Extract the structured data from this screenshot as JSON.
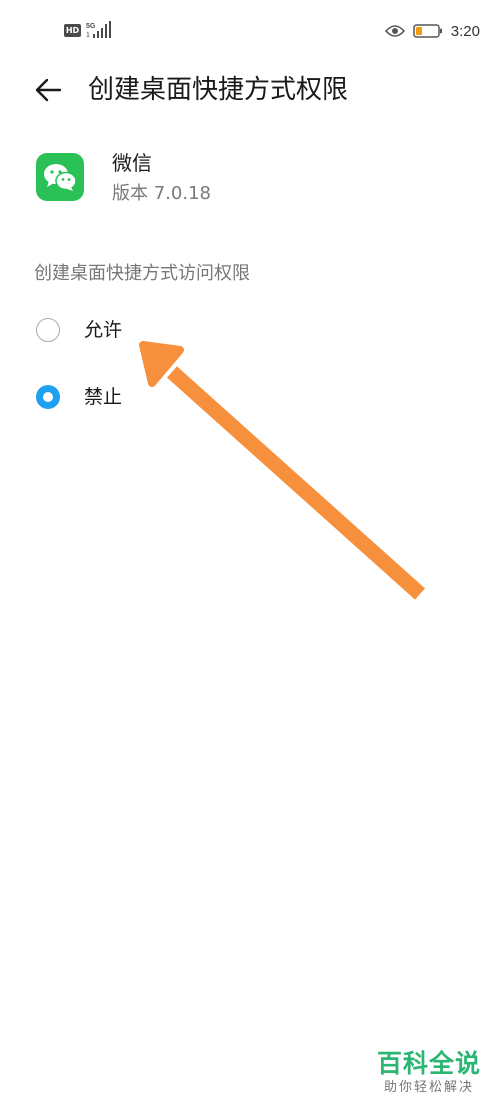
{
  "status_bar": {
    "network_badge": "HD",
    "network_type": "5G",
    "time": "3:20",
    "battery_color": "#f39c12"
  },
  "header": {
    "title": "创建桌面快捷方式权限"
  },
  "app": {
    "name": "微信",
    "version": "版本 7.0.18",
    "icon_color": "#2ac156"
  },
  "permission": {
    "section_label": "创建桌面快捷方式访问权限",
    "options": [
      {
        "label": "允许",
        "selected": false
      },
      {
        "label": "禁止",
        "selected": true
      }
    ],
    "accent_color": "#1ea0f0"
  },
  "annotation": {
    "arrow_color": "#f7903c"
  },
  "watermark": {
    "main": "百科全说",
    "sub": "助你轻松解决",
    "color": "#2bb673"
  }
}
